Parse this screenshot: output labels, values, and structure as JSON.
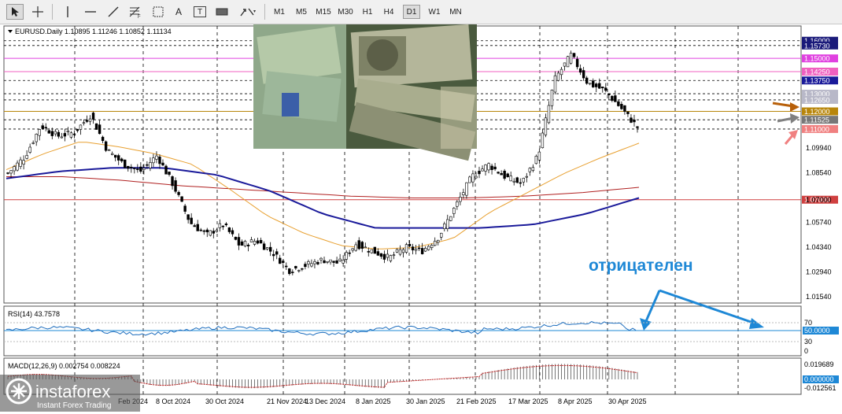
{
  "toolbar": {
    "tools": [
      {
        "name": "cursor-icon"
      },
      {
        "name": "crosshair-icon"
      },
      {
        "name": "vertical-line-icon"
      },
      {
        "name": "horizontal-line-icon"
      },
      {
        "name": "trendline-icon"
      },
      {
        "name": "fibonacci-icon"
      },
      {
        "name": "grid-icon"
      },
      {
        "name": "text-icon",
        "label": "A"
      },
      {
        "name": "text-label-icon",
        "label": "T"
      },
      {
        "name": "rectangle-icon"
      },
      {
        "name": "arrows-icon"
      }
    ],
    "timeframes": [
      "M1",
      "M5",
      "M15",
      "M30",
      "H1",
      "H4",
      "D1",
      "W1",
      "MN"
    ],
    "active_timeframe": "D1"
  },
  "main": {
    "symbol_header": "EURUSD.Daily  1.10895 1.11246 1.10852 1.11134",
    "annotation_text": "отрицателен",
    "colors": {
      "candles": "#000000",
      "ma_fast": "#e8a030",
      "ma_slow": "#1a1a9a",
      "ma_long": "#b02020",
      "annotation": "#1e88d6"
    },
    "price_labels": [
      {
        "value": 1.16,
        "text": "1.16000",
        "bg": "#1a1a7a"
      },
      {
        "value": 1.1573,
        "text": "1.15730",
        "bg": "#1a1a7a"
      },
      {
        "value": 1.15,
        "text": "1.15000",
        "bg": "#e040e0"
      },
      {
        "value": 1.1425,
        "text": "1.14250",
        "bg": "#f060c0"
      },
      {
        "value": 1.1375,
        "text": "1.13750",
        "bg": "#1a1a9a"
      },
      {
        "value": 1.13,
        "text": "1.13000",
        "bg": "#b8b8c8"
      },
      {
        "value": 1.1265,
        "text": "1.12650",
        "bg": "#b8b8c8"
      },
      {
        "value": 1.12,
        "text": "1.12000",
        "bg": "#b8860b"
      },
      {
        "value": 1.11525,
        "text": "1.11525",
        "bg": "#777777"
      },
      {
        "value": 1.11,
        "text": "1.11000",
        "bg": "#f08080"
      },
      {
        "value": 1.07,
        "text": "1.07000",
        "bg": "#d04040"
      }
    ],
    "price_ticks": [
      "1.09940",
      "1.08540",
      "1.07000",
      "1.05740",
      "1.04340",
      "1.02940",
      "1.01540"
    ],
    "arrows": [
      {
        "name": "brown-arrow-icon",
        "color": "#b8600a",
        "target": 1.12
      },
      {
        "name": "gray-arrow-icon",
        "color": "#808080",
        "target": 1.11525
      },
      {
        "name": "pink-arrow-icon",
        "color": "#f08080",
        "target": 1.11
      }
    ]
  },
  "rsi": {
    "header": "RSI(14) 43.7578",
    "levels": [
      "70",
      "50.0000",
      "30",
      "0"
    ],
    "line_color": "#1e6ebe"
  },
  "macd": {
    "header": "MACD(12,26,9) 0.002754 0.008224",
    "levels": [
      "0.019689",
      "0.000000",
      "-0.012561"
    ]
  },
  "xaxis": {
    "labels": [
      "Feb 2024",
      "8 Oct 2024",
      "30 Oct 2024",
      "21 Nov 2024",
      "13 Dec 2024",
      "8 Jan 2025",
      "30 Jan 2025",
      "21 Feb 2025",
      "17 Mar 2025",
      "8 Apr 2025",
      "30 Apr 2025"
    ]
  },
  "branding": {
    "logo_text": "instaforex",
    "tagline": "Instant Forex Trading"
  },
  "chart_data": {
    "type": "candlestick",
    "symbol": "EURUSD.Daily",
    "ohlc_last": {
      "open": 1.10895,
      "high": 1.11246,
      "low": 1.10852,
      "close": 1.11134
    },
    "x": [
      "Feb 2024",
      "8 Oct 2024",
      "30 Oct 2024",
      "21 Nov 2024",
      "13 Dec 2024",
      "8 Jan 2025",
      "30 Jan 2025",
      "21 Feb 2025",
      "17 Mar 2025",
      "8 Apr 2025",
      "30 Apr 2025"
    ],
    "close_path": [
      1.085,
      1.094,
      1.112,
      1.106,
      1.108,
      1.118,
      1.098,
      1.09,
      1.086,
      1.095,
      1.078,
      1.057,
      1.05,
      1.056,
      1.044,
      1.047,
      1.04,
      1.03,
      1.033,
      1.036,
      1.034,
      1.045,
      1.041,
      1.037,
      1.043,
      1.041,
      1.049,
      1.066,
      1.083,
      1.09,
      1.083,
      1.079,
      1.095,
      1.138,
      1.152,
      1.136,
      1.132,
      1.122,
      1.111
    ],
    "ma_fast_path": [
      1.087,
      1.096,
      1.103,
      1.1,
      1.096,
      1.09,
      1.076,
      1.061,
      1.051,
      1.044,
      1.042,
      1.043,
      1.048,
      1.063,
      1.074,
      1.085,
      1.094,
      1.102
    ],
    "ma_slow_path": [
      1.082,
      1.086,
      1.088,
      1.088,
      1.084,
      1.075,
      1.062,
      1.054,
      1.054,
      1.054,
      1.056,
      1.062,
      1.071
    ],
    "ma_long_path": [
      1.083,
      1.083,
      1.081,
      1.078,
      1.076,
      1.074,
      1.072,
      1.071,
      1.071,
      1.072,
      1.074,
      1.077
    ],
    "ylim": [
      1.0124,
      1.163
    ]
  }
}
